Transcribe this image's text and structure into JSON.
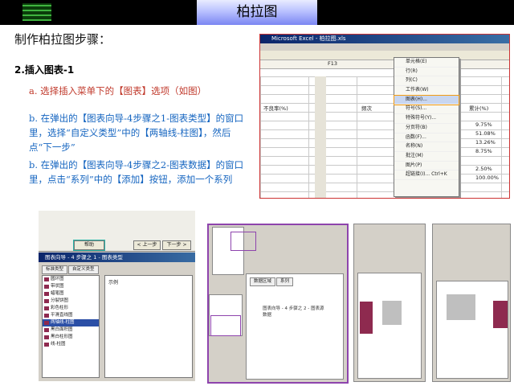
{
  "banner": {
    "title": "柏拉图"
  },
  "heading": "制作柏拉图步骤：",
  "subheading": "2.插入图表-1",
  "steps": {
    "a": "a. 选择插入菜单下的【图表】选项（如图）",
    "b1": "b. 在弹出的【图表向导-4步骤之1-图表类型】的窗口里，选择“自定义类型”中的【两轴线-柱图】，然后点“下一步”",
    "b2": "b. 在弹出的【图表向导-4步骤之2-图表数据】的窗口里，点击“系列”中的【添加】按钮，添加一个系列"
  },
  "excel_shot": {
    "title": "Microsoft Excel - 柏拉图.xls",
    "name_box": "F13",
    "menu_items": [
      "单元格(E)",
      "行(R)",
      "列(C)",
      "工作表(W)",
      "图表(H)...",
      "符号(S)...",
      "特殊符号(Y)...",
      "分页符(B)",
      "函数(F)...",
      "名称(N)",
      "批注(M)",
      "图片(P)",
      "超链接(I)... Ctrl+K"
    ],
    "cells": [
      "不良率(%)",
      "频次",
      "累计(%)",
      "9.75%",
      "51.08%",
      "13.26%",
      "8.75%",
      "2.50%",
      "100.00%"
    ]
  },
  "wizard1": {
    "buttons": [
      "帮助",
      "< 上一步",
      "下一步 >"
    ],
    "title": "图表向导 - 4 步骤之 1 - 图表类型",
    "tabs": [
      "标准类型",
      "自定义类型"
    ],
    "list": [
      "圆环图",
      "带状图",
      "蜡笔图",
      "分裂饼图",
      "彩色柱形",
      "平滑直线图",
      "两轴线-柱图",
      "黑白面积图",
      "黑白柱形图",
      "线-柱图"
    ],
    "preview_label": "示例"
  },
  "wizard2": {
    "tabs": [
      "数据区域",
      "系列"
    ],
    "caption": "图表向导 - 4 步骤之 2 - 图表源数据"
  }
}
